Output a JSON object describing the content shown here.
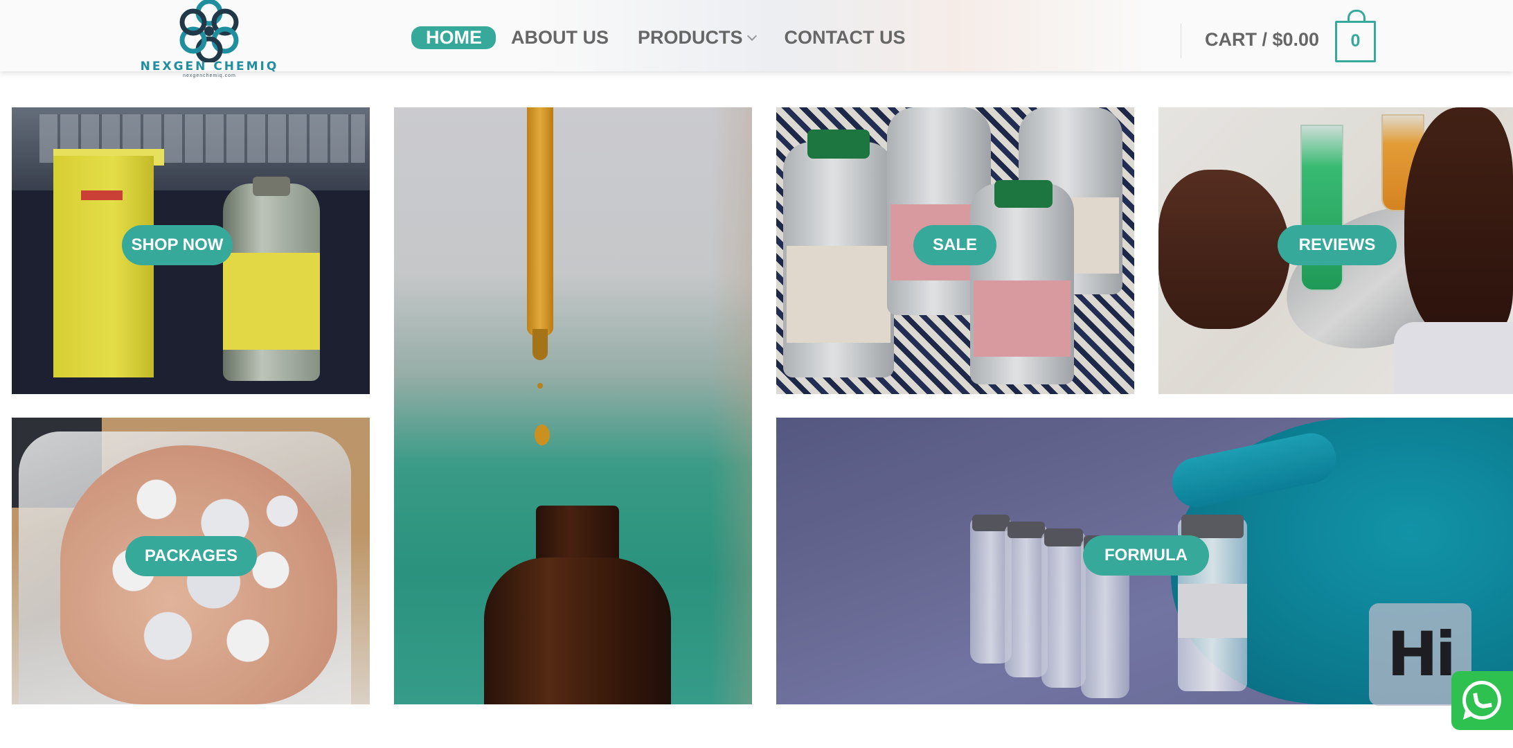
{
  "brand": {
    "name": "NEXGEN CHEMIQ",
    "tagline": "nexgenchemiq.com"
  },
  "nav": {
    "items": [
      {
        "label": "HOME",
        "active": true
      },
      {
        "label": "ABOUT US",
        "active": false
      },
      {
        "label": "PRODUCTS",
        "active": false,
        "has_dropdown": true
      },
      {
        "label": "CONTACT US",
        "active": false
      }
    ]
  },
  "cart": {
    "label": "CART / $0.00",
    "count": "0"
  },
  "tiles": [
    {
      "label": "SHOP NOW"
    },
    {
      "label": "SALE"
    },
    {
      "label": "REVIEWS"
    },
    {
      "label": "PACKAGES"
    },
    {
      "label": "FORMULA"
    }
  ],
  "widgets": {
    "hi_label": "Hi",
    "whatsapp_icon": "whatsapp-icon"
  },
  "colors": {
    "accent": "#37a99b",
    "nav_text": "#666666",
    "whatsapp": "#2ec14f"
  }
}
